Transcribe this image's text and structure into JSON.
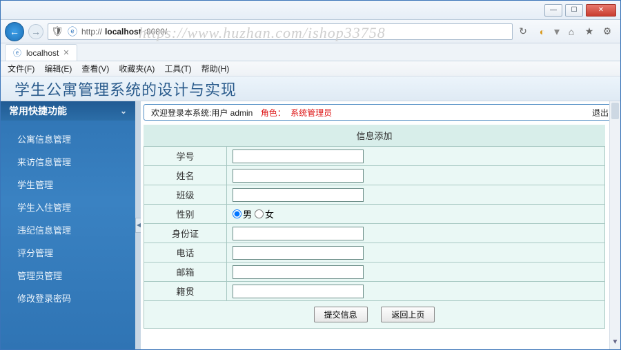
{
  "window": {
    "url_prefix": "http://",
    "url_host": "localhost",
    "url_port_path": ":8080/",
    "tab_title": "localhost",
    "watermark": "https://www.huzhan.com/ishop33758"
  },
  "menubar": [
    "文件(F)",
    "编辑(E)",
    "查看(V)",
    "收藏夹(A)",
    "工具(T)",
    "帮助(H)"
  ],
  "app": {
    "title": "学生公寓管理系统的设计与实现",
    "sidebar_title": "常用快捷功能",
    "sidebar_items": [
      "公寓信息管理",
      "来访信息管理",
      "学生管理",
      "学生入住管理",
      "违纪信息管理",
      "评分管理",
      "管理员管理",
      "修改登录密码"
    ]
  },
  "topbar": {
    "welcome": "欢迎登录本系统:用户 admin",
    "role_label": "角色：",
    "role_value": "系统管理员",
    "logout": "退出"
  },
  "form": {
    "title": "信息添加",
    "labels": {
      "sno": "学号",
      "name": "姓名",
      "class": "班级",
      "gender": "性别",
      "gender_m": "男",
      "gender_f": "女",
      "idcard": "身份证",
      "phone": "电话",
      "email": "邮箱",
      "native": "籍贯"
    },
    "values": {
      "sno": "",
      "name": "",
      "class": "",
      "idcard": "",
      "phone": "",
      "email": "",
      "native": ""
    },
    "gender_selected": "男",
    "submit": "提交信息",
    "back": "返回上页"
  }
}
